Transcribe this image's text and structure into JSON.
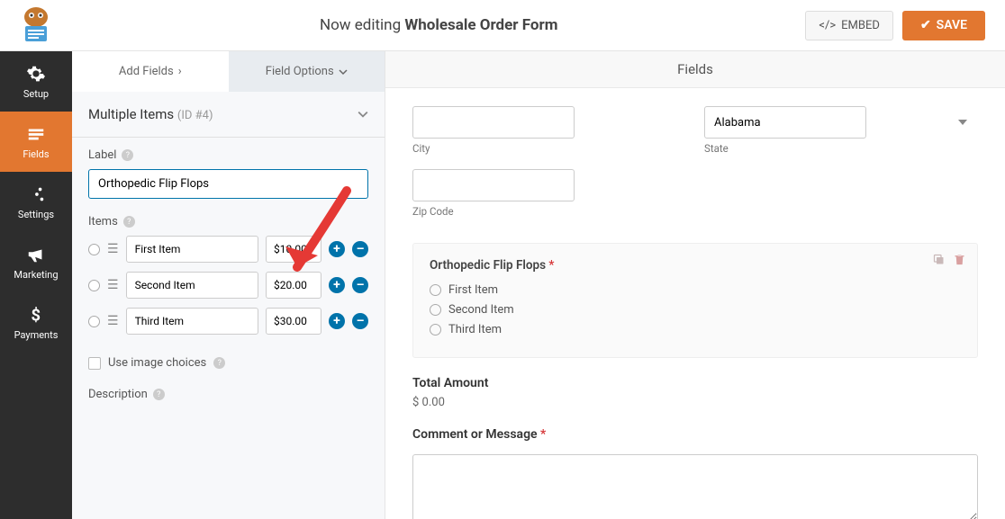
{
  "header": {
    "editing_prefix": "Now editing",
    "form_name": "Wholesale Order Form",
    "embed_label": "EMBED",
    "save_label": "SAVE"
  },
  "sidebar": {
    "items": [
      {
        "label": "Setup"
      },
      {
        "label": "Fields"
      },
      {
        "label": "Settings"
      },
      {
        "label": "Marketing"
      },
      {
        "label": "Payments"
      }
    ]
  },
  "panel": {
    "tabs": {
      "add": "Add Fields",
      "options": "Field Options"
    },
    "section_title": "Multiple Items",
    "section_id": "(ID #4)",
    "label_label": "Label",
    "label_value": "Orthopedic Flip Flops",
    "items_label": "Items",
    "items": [
      {
        "name": "First Item",
        "price": "$10.00"
      },
      {
        "name": "Second Item",
        "price": "$20.00"
      },
      {
        "name": "Third Item",
        "price": "$30.00"
      }
    ],
    "use_image_choices": "Use image choices",
    "description_label": "Description"
  },
  "preview": {
    "header": "Fields",
    "city_label": "City",
    "state_label": "State",
    "state_value": "Alabama",
    "zip_label": "Zip Code",
    "multi_title": "Orthopedic Flip Flops",
    "options": [
      "First Item",
      "Second Item",
      "Third Item"
    ],
    "total_label": "Total Amount",
    "total_value": "$ 0.00",
    "comment_label": "Comment or Message"
  }
}
